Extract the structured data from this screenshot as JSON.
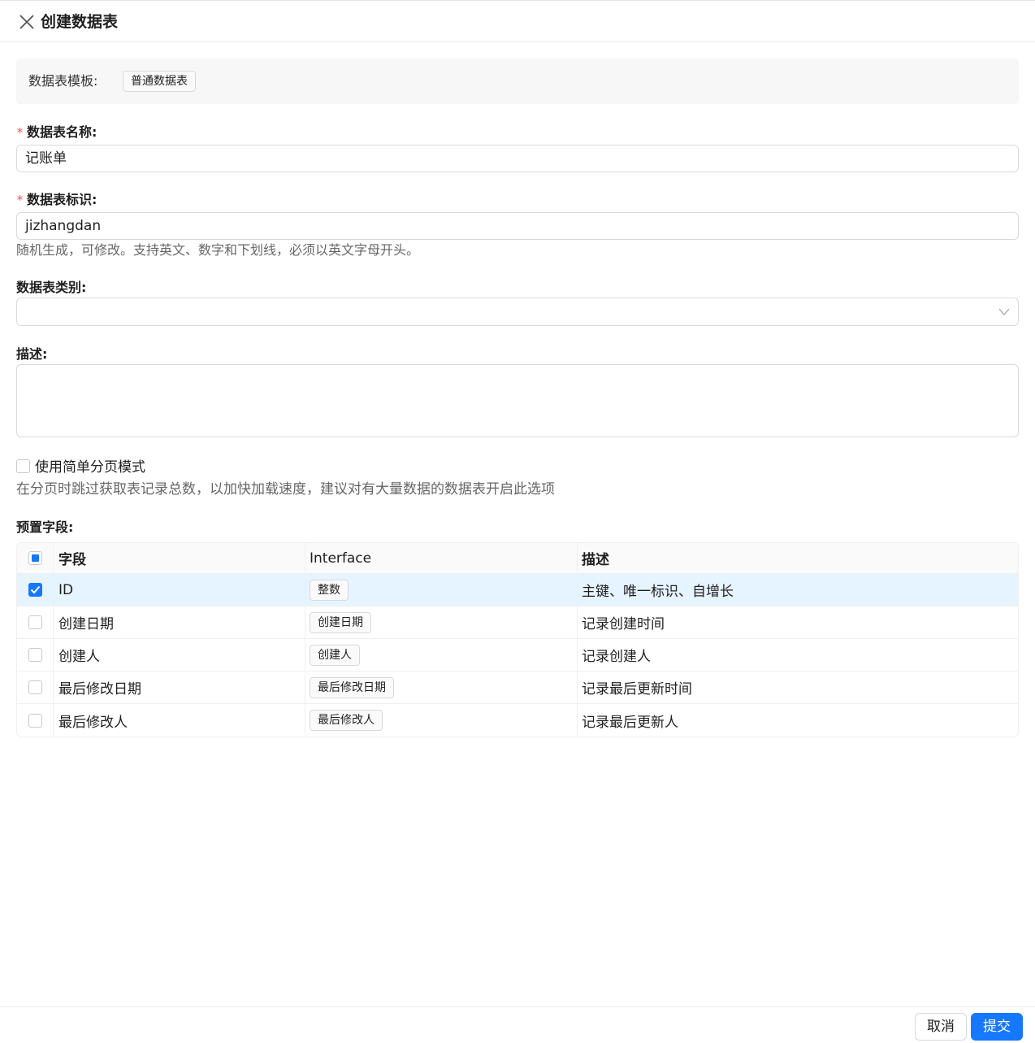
{
  "header": {
    "title": "创建数据表"
  },
  "template": {
    "label": "数据表模板:",
    "value": "普通数据表"
  },
  "form": {
    "name": {
      "label": "数据表名称",
      "required_mark": "*",
      "colon": ":",
      "value": "记账单"
    },
    "identifier": {
      "label": "数据表标识",
      "required_mark": "*",
      "colon": ":",
      "value": "jizhangdan",
      "hint": "随机生成，可修改。支持英文、数字和下划线，必须以英文字母开头。"
    },
    "category": {
      "label": "数据表类别:",
      "value": ""
    },
    "description": {
      "label": "描述:",
      "value": ""
    },
    "simple_pagination": {
      "label": "使用简单分页模式",
      "checked": false,
      "hint": "在分页时跳过获取表记录总数，以加快加载速度，建议对有大量数据的数据表开启此选项"
    },
    "preset_fields_label": "预置字段:"
  },
  "table": {
    "columns": [
      "字段",
      "Interface",
      "描述"
    ],
    "rows": [
      {
        "field": "ID",
        "interface": "整数",
        "description": "主键、唯一标识、自增长",
        "checked": true
      },
      {
        "field": "创建日期",
        "interface": "创建日期",
        "description": "记录创建时间",
        "checked": false
      },
      {
        "field": "创建人",
        "interface": "创建人",
        "description": "记录创建人",
        "checked": false
      },
      {
        "field": "最后修改日期",
        "interface": "最后修改日期",
        "description": "记录最后更新时间",
        "checked": false
      },
      {
        "field": "最后修改人",
        "interface": "最后修改人",
        "description": "记录最后更新人",
        "checked": false
      }
    ]
  },
  "footer": {
    "cancel_label": "取消",
    "submit_label": "提交"
  },
  "colors": {
    "primary": "#1677ff",
    "required": "#ff4d4f",
    "selected_row": "#e6f4ff"
  },
  "icons": {
    "close": "close-icon",
    "select_arrow": "chevron-down-icon",
    "check": "check-icon"
  }
}
